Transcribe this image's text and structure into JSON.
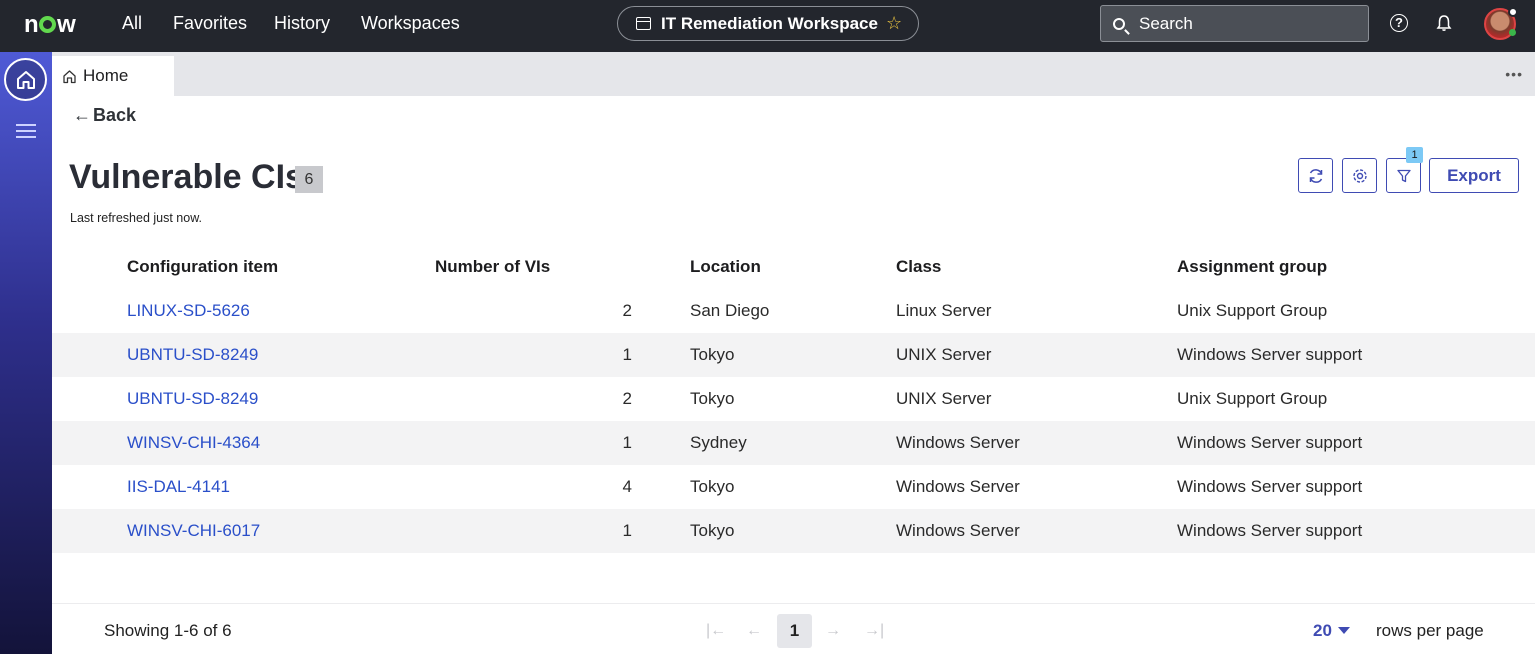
{
  "topbar": {
    "logo": "now",
    "nav": [
      "All",
      "Favorites",
      "History",
      "Workspaces"
    ],
    "workspace": "IT Remediation Workspace",
    "search_placeholder": "Search"
  },
  "tabs": {
    "home": "Home"
  },
  "page": {
    "back_label": "Back",
    "title": "Vulnerable CIs",
    "count": "6",
    "refresh_note": "Last refreshed just now.",
    "filter_count": "1",
    "export_label": "Export"
  },
  "table": {
    "headers": [
      "Configuration item",
      "Number of VIs",
      "Location",
      "Class",
      "Assignment group"
    ],
    "rows": [
      {
        "ci": "LINUX-SD-5626",
        "vis": "2",
        "location": "San Diego",
        "class": "Linux Server",
        "group": "Unix Support Group"
      },
      {
        "ci": "UBNTU-SD-8249",
        "vis": "1",
        "location": "Tokyo",
        "class": "UNIX Server",
        "group": "Windows Server support"
      },
      {
        "ci": "UBNTU-SD-8249",
        "vis": "2",
        "location": "Tokyo",
        "class": "UNIX Server",
        "group": "Unix Support Group"
      },
      {
        "ci": "WINSV-CHI-4364",
        "vis": "1",
        "location": "Sydney",
        "class": "Windows Server",
        "group": "Windows Server support"
      },
      {
        "ci": "IIS-DAL-4141",
        "vis": "4",
        "location": "Tokyo",
        "class": "Windows Server",
        "group": "Windows Server support"
      },
      {
        "ci": "WINSV-CHI-6017",
        "vis": "1",
        "location": "Tokyo",
        "class": "Windows Server",
        "group": "Windows Server support"
      }
    ]
  },
  "footer": {
    "showing": "Showing 1-6 of 6",
    "current_page": "1",
    "rows_per_page": "20",
    "rows_label": "rows per page"
  }
}
